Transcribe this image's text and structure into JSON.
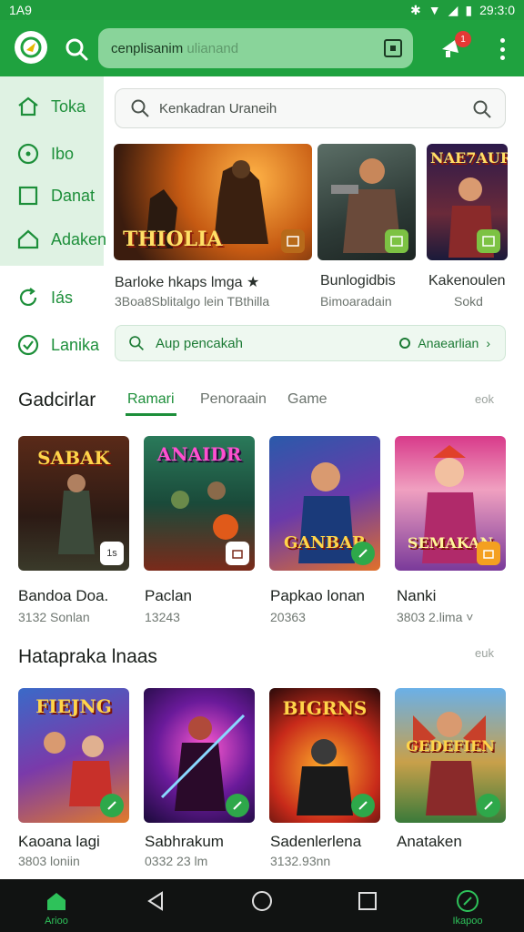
{
  "status_bar": {
    "time": "1A9",
    "clock": "29:3:0"
  },
  "app_bar": {
    "search_value": "cenplisanim",
    "search_placeholder": "ulianand",
    "notification_count": "1"
  },
  "sidebar": {
    "items": [
      {
        "label": "Toka",
        "icon": "home-icon"
      },
      {
        "label": "Ibo",
        "icon": "target-icon"
      },
      {
        "label": "Danat",
        "icon": "square-icon"
      },
      {
        "label": "Adaken",
        "icon": "house-icon"
      },
      {
        "label": "Iás",
        "icon": "refresh-icon"
      },
      {
        "label": "Lanika",
        "icon": "check-circle-icon"
      }
    ]
  },
  "main_search": {
    "placeholder": "Kenkadran Uraneih"
  },
  "banners": [
    {
      "title": "Barloke hkaps lmga ★",
      "subtitle": "3Boa8Sblitalgo lein TBthilla",
      "art_text": "THIOLIA"
    },
    {
      "title": "Bunlogidbis",
      "subtitle": "Bimoaradain",
      "art_text": ""
    },
    {
      "title": "Kakenoulen",
      "subtitle": "Sokd",
      "art_text": "NAE7AUR"
    }
  ],
  "promo": {
    "text": "Aup pencakah",
    "action": "Anaearlian"
  },
  "section1": {
    "title": "Gadcirlar",
    "tabs": [
      "Ramari",
      "Penoraain",
      "Game"
    ],
    "more": "eok",
    "cards": [
      {
        "title": "Bandoa Doa.",
        "sub": "3132 Sonlan",
        "art": "SABAK",
        "badge": "1s"
      },
      {
        "title": "Paclan",
        "sub": "13243",
        "art": "ANAIDR",
        "badge": ""
      },
      {
        "title": "Papkao lonan",
        "sub": "20363",
        "art": "GANBAR",
        "badge": ""
      },
      {
        "title": "Nanki",
        "sub": "3803 2.lima ˅",
        "art": "SEMAKAN",
        "badge": ""
      }
    ]
  },
  "section2": {
    "title": "Hatapraka lnaas",
    "more": "euk",
    "cards": [
      {
        "title": "Kaoana lagi",
        "sub": "3803 loniin",
        "art": "FIEJNG",
        "badge": ""
      },
      {
        "title": "Sabhrakum",
        "sub": "0332 23 lm",
        "art": "",
        "badge": ""
      },
      {
        "title": "Sadenlerlena",
        "sub": "3132.93nn",
        "art": "BIGRNS",
        "badge": ""
      },
      {
        "title": "Anataken",
        "sub": "",
        "art": "GEDEFIEN",
        "badge": ""
      }
    ]
  },
  "bottom_nav": {
    "left_label": "Arioo",
    "right_label": "Ikapoo"
  },
  "colors": {
    "brand_green": "#1fa23f",
    "accent": "#1d8f3a"
  }
}
